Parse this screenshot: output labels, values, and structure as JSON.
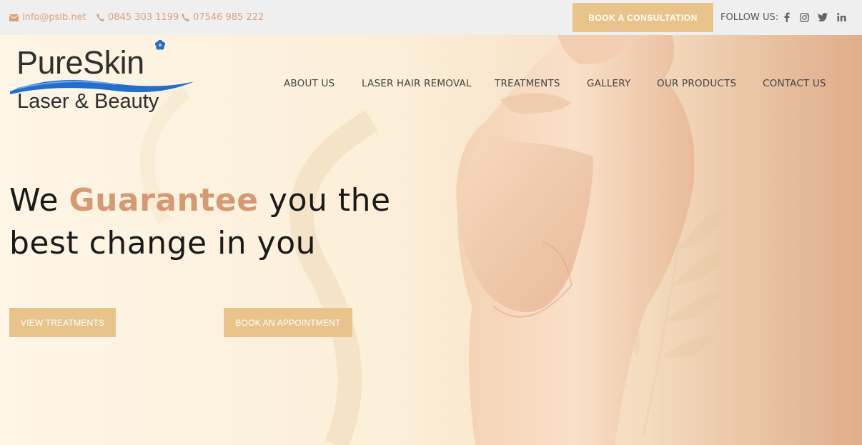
{
  "topbar": {
    "email": "info@pslb.net",
    "phone1": "0845 303 1199",
    "phone2": "07546 985 222",
    "book_consultation": "BOOK A CONSULTATION",
    "follow_label": "FOLLOW US:",
    "social": [
      "facebook-icon",
      "instagram-icon",
      "twitter-icon",
      "linkedin-icon"
    ]
  },
  "logo": {
    "main": "PureSkin",
    "sub": "Laser & Beauty"
  },
  "nav": [
    "ABOUT US",
    "LASER HAIR REMOVAL",
    "TREATMENTS",
    "GALLERY",
    "OUR PRODUCTS",
    "CONTACT US"
  ],
  "hero": {
    "line1_pre": "We ",
    "line1_accent": "Guarantee",
    "line1_post": " you the",
    "line2": "best change in you",
    "btn_treatments": "VIEW TREATMENTS",
    "btn_appointment": "BOOK AN APPOINTMENT"
  },
  "colors": {
    "accent": "#e8c48b",
    "headline_accent": "#d69a72",
    "contact_text": "#d7a17a",
    "logo_wave": "#1e6fd0"
  }
}
